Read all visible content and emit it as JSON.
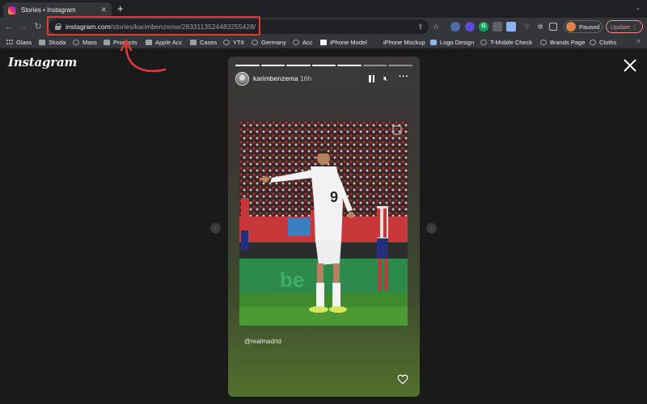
{
  "browser": {
    "tab_title": "Stories • Instagram",
    "tab_close": "✕",
    "new_tab": "+",
    "tabstrip_chevron": "⌄",
    "url_host": "instagram.com",
    "url_path": "/stories/karimbenzema/2833113524483255428/",
    "profile_label": "Paused",
    "update_label": "Update",
    "update_menu": "⋮",
    "bookmarks": [
      {
        "label": "Glass",
        "icon": "apps-icon"
      },
      {
        "label": "Skoda",
        "icon": "folder-icon"
      },
      {
        "label": "Mass",
        "icon": "globe-icon"
      },
      {
        "label": "Products",
        "icon": "folder-icon"
      },
      {
        "label": "Apple Acc",
        "icon": "folder-icon"
      },
      {
        "label": "Cases",
        "icon": "folder-icon"
      },
      {
        "label": "YT#",
        "icon": "globe-icon"
      },
      {
        "label": "Germany",
        "icon": "globe-icon"
      },
      {
        "label": "Acc",
        "icon": "globe-icon"
      },
      {
        "label": "iPhone Model",
        "icon": "dark-icon"
      },
      {
        "label": "iPhone Mockup",
        "icon": "none"
      },
      {
        "label": "Logo Design",
        "icon": "logo-icon"
      },
      {
        "label": "T-Mobile Check",
        "icon": "globe-icon"
      },
      {
        "label": "Brands Page",
        "icon": "globe-icon"
      },
      {
        "label": "Cloths",
        "icon": "globe-icon"
      }
    ],
    "bookmarks_more": "»"
  },
  "page": {
    "logo": "Instagram",
    "story": {
      "username": "karimbenzema",
      "time_ago": "16h",
      "mention": "@realmadrid",
      "segments_total": 7,
      "segments_done": 5
    }
  },
  "colors": {
    "highlight": "#e53935"
  }
}
